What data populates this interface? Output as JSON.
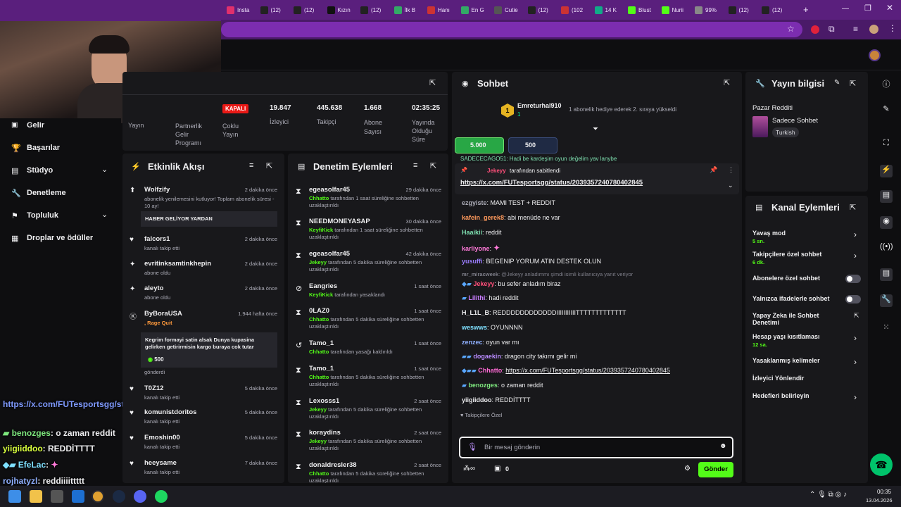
{
  "browser": {
    "tabs": [
      {
        "label": "Insta",
        "color": "#e1306c"
      },
      {
        "label": "(12)",
        "color": "#222"
      },
      {
        "label": "(12)",
        "color": "#222"
      },
      {
        "label": "Kızın",
        "color": "#111"
      },
      {
        "label": "(12)",
        "color": "#222"
      },
      {
        "label": "İlk B",
        "color": "#3a6"
      },
      {
        "label": "Hanı",
        "color": "#c33"
      },
      {
        "label": "En G",
        "color": "#3a6"
      },
      {
        "label": "Cutie",
        "color": "#555"
      },
      {
        "label": "(12)",
        "color": "#222"
      },
      {
        "label": "(102",
        "color": "#c33"
      },
      {
        "label": "14 K",
        "color": "#1a8"
      },
      {
        "label": "Blust",
        "color": "#53fc18"
      },
      {
        "label": "Nurii",
        "color": "#53fc18"
      },
      {
        "label": "99%",
        "color": "#888"
      },
      {
        "label": "(12)",
        "color": "#222"
      },
      {
        "label": "(12)",
        "color": "#222"
      }
    ],
    "new_tab": "+"
  },
  "stats": {
    "closed_badge": "KAPALI",
    "yayin_label": "Yayın",
    "partnerlik": "Partnerlik Gelir Programı",
    "coklu": "Çoklu Yayın",
    "viewers": {
      "value": "19.847",
      "label": "İzleyici"
    },
    "followers": {
      "value": "445.638",
      "label": "Takipçi"
    },
    "subs": {
      "value": "1.668",
      "label": "Abone Sayısı"
    },
    "uptime": {
      "value": "02:35:25",
      "label": "Yayında Olduğu Süre"
    }
  },
  "leftnav": {
    "items": [
      {
        "label": "Gelir"
      },
      {
        "label": "Başarılar"
      },
      {
        "label": "Stüdyo"
      },
      {
        "label": "Denetleme"
      },
      {
        "label": "Topluluk"
      },
      {
        "label": "Droplar ve ödüller"
      }
    ]
  },
  "activity": {
    "title": "Etkinlik Akışı",
    "items": [
      {
        "user": "Wolfzify",
        "time": "2 dakika önce",
        "text": "abonelik yenilemesini kutluyor! Toplam abonelik süresi - 10 ay!",
        "note": "HABER GELİYOR YARDAN"
      },
      {
        "user": "falcors1",
        "time": "2 dakika önce",
        "text": "kanalı takip etti"
      },
      {
        "user": "evritinksamtinkhepin",
        "time": "2 dakika önce",
        "text": "abone oldu"
      },
      {
        "user": "aleyto",
        "time": "2 dakika önce",
        "text": "abone oldu"
      },
      {
        "user": "ByBoraUSA",
        "time": "1.944 hafta önce",
        "text": ", Rage Quit",
        "note": "Kegrim formayi satin alsak Dunya kupasina gelirken getirirmisin kargo buraya cok tutar",
        "amount": "500",
        "sent": "gönderdi"
      },
      {
        "user": "T0Z12",
        "time": "5 dakika önce",
        "text": "kanalı takip etti"
      },
      {
        "user": "komunistdoritos",
        "time": "5 dakika önce",
        "text": "kanalı takip etti"
      },
      {
        "user": "Emoshin00",
        "time": "5 dakika önce",
        "text": "kanalı takip etti"
      },
      {
        "user": "heeysame",
        "time": "7 dakika önce",
        "text": "kanalı takip etti"
      }
    ]
  },
  "moderation": {
    "title": "Denetim Eylemleri",
    "items": [
      {
        "user": "egeasolfar45",
        "time": "29 dakika önce",
        "mod": "Chhatto",
        "text": "tarafından 1 saat süreliğine sohbetten uzaklaştırıldı"
      },
      {
        "user": "NEEDMONEYASAP",
        "time": "30 dakika önce",
        "mod": "KeyfiKick",
        "text": "tarafından 1 saat süreliğine sohbetten uzaklaştırıldı"
      },
      {
        "user": "egeasolfar45",
        "time": "42 dakika önce",
        "mod": "Jekeyy",
        "text": "tarafından 5 dakika süreliğine sohbetten uzaklaştırıldı"
      },
      {
        "user": "Eangries",
        "time": "1 saat önce",
        "mod": "KeyfiKick",
        "text": "tarafından yasaklandı"
      },
      {
        "user": "0LAZ0",
        "time": "1 saat önce",
        "mod": "Chhatto",
        "text": "tarafından 5 dakika süreliğine sohbetten uzaklaştırıldı"
      },
      {
        "user": "Tamo_1",
        "time": "1 saat önce",
        "mod": "Chhatto",
        "text": "tarafından yasağı kaldırıldı"
      },
      {
        "user": "Tamo_1",
        "time": "1 saat önce",
        "mod": "Chhatto",
        "text": "tarafından 5 dakika süreliğine sohbetten uzaklaştırıldı"
      },
      {
        "user": "Lexosss1",
        "time": "2 saat önce",
        "mod": "Jekeyy",
        "text": "tarafından 5 dakika süreliğine sohbetten uzaklaştırıldı"
      },
      {
        "user": "koraydins",
        "time": "2 saat önce",
        "mod": "Jekeyy",
        "text": "tarafından 5 dakika süreliğine sohbetten uzaklaştırıldı"
      },
      {
        "user": "donaldresler38",
        "time": "2 saat önce",
        "mod": "Chhatto",
        "text": "tarafından 5 dakika süreliğine sohbetten uzaklaştırıldı"
      }
    ]
  },
  "chat": {
    "title": "Sohbet",
    "gift_user": "Emreturhal910",
    "gift_count": "1",
    "gift_text": "1 abonelik hediye ederek 2. sıraya yükseldi",
    "points_a": "5.000",
    "points_b": "500",
    "cut_line": "SADECECAGO51: Hadi be kardeşim oyun değelim yav lanybe",
    "pinned_by": "Jekeyy",
    "pinned_label": "tarafından sabitlendi",
    "pinned_link": "https://x.com/FUTesportsgg/status/2039357240780402845",
    "messages": [
      {
        "user": "ezgyiste",
        "color": "#adadb8",
        "text": "MAMI TEST + REDDIT"
      },
      {
        "user": "kafein_gerek8",
        "color": "#ff9a5c",
        "text": "abi menüde ne var"
      },
      {
        "user": "Haaikii",
        "color": "#7ee0b0",
        "text": "reddit"
      },
      {
        "user": "karliyone",
        "color": "#ff7ad9",
        "text": ""
      },
      {
        "user": "yusuffi",
        "color": "#9b7dff",
        "text": "BEGENIP YORUM ATIN DESTEK OLUN"
      },
      {
        "user": "mr_miracweek",
        "color": "#7f7f8a",
        "text": "@Jekeyy anladımmı şimdi isimli kullanıcıya yanıt veriyor"
      },
      {
        "user": "Jekeyy",
        "color": "#ff4f7a",
        "text": "bu sefer anladım biraz"
      },
      {
        "user": "Lilithi",
        "color": "#c97dff",
        "text": "hadi reddit"
      },
      {
        "user": "H_L1L_B",
        "color": "#efeff1",
        "text": "REDDDDDDDDDDDDIIIIIIIIIIITTTTTTTTTTTTT"
      },
      {
        "user": "weswws",
        "color": "#7fe0ff",
        "text": "OYUNNNN"
      },
      {
        "user": "zenzec",
        "color": "#8fb0ff",
        "text": "oyun var mı"
      },
      {
        "user": "dogaekin",
        "color": "#b98bff",
        "text": "dragon city takımı gelir mi"
      },
      {
        "user": "Chhatto",
        "color": "#ff6ad5",
        "text": "https://x.com/FUTesportsgg/status/2039357240780402845"
      },
      {
        "user": "benozges",
        "color": "#7ee87e",
        "text": "o zaman reddit"
      },
      {
        "user": "yiigiiddoo",
        "color": "#efeff1",
        "text": "REDDİTTTT"
      }
    ],
    "followers_only": "Takipçilere Özel",
    "input_placeholder": "Bir mesaj gönderin",
    "bits": "0",
    "send": "Gönder"
  },
  "stream_info": {
    "title": "Yayın bilgisi",
    "stream_title": "Pazar Redditi",
    "category": "Sadece Sohbet",
    "tag": "Turkish"
  },
  "channel_actions": {
    "title": "Kanal Eylemleri",
    "items": [
      {
        "label": "Yavaş mod",
        "sub": "5 sn."
      },
      {
        "label": "Takipçilere özel sohbet",
        "sub": "6 dk."
      },
      {
        "label": "Abonelere özel sohbet",
        "sub": ""
      },
      {
        "label": "Yalnızca ifadelerle sohbet",
        "sub": ""
      },
      {
        "label": "Yapay Zeka ile Sohbet Denetimi",
        "sub": ""
      },
      {
        "label": "Hesap yaşı kısıtlaması",
        "sub": "12 sa."
      },
      {
        "label": "Yasaklanmış kelimeler",
        "sub": ""
      },
      {
        "label": "İzleyici Yönlendir",
        "sub": ""
      },
      {
        "label": "Hedefleri belirleyin",
        "sub": ""
      }
    ]
  },
  "overlay": {
    "link": "https://x.com/FUTesportsgg/status/2039357240780402845",
    "lines": [
      {
        "user": "benozges",
        "text": ": o zaman reddit",
        "color": "#7ee87e"
      },
      {
        "user": "yiigiiddoo",
        "text": ": REDDİTTTT",
        "color": "#d9ff3d"
      },
      {
        "user": "EfeLac",
        "text": ":",
        "color": "#7fe0ff"
      },
      {
        "user": "rojhatyzl",
        "text": ": reddiiiittttt",
        "color": "#8fb0ff"
      }
    ]
  },
  "taskbar": {
    "time": "00:35",
    "date": "13.04.2026"
  }
}
